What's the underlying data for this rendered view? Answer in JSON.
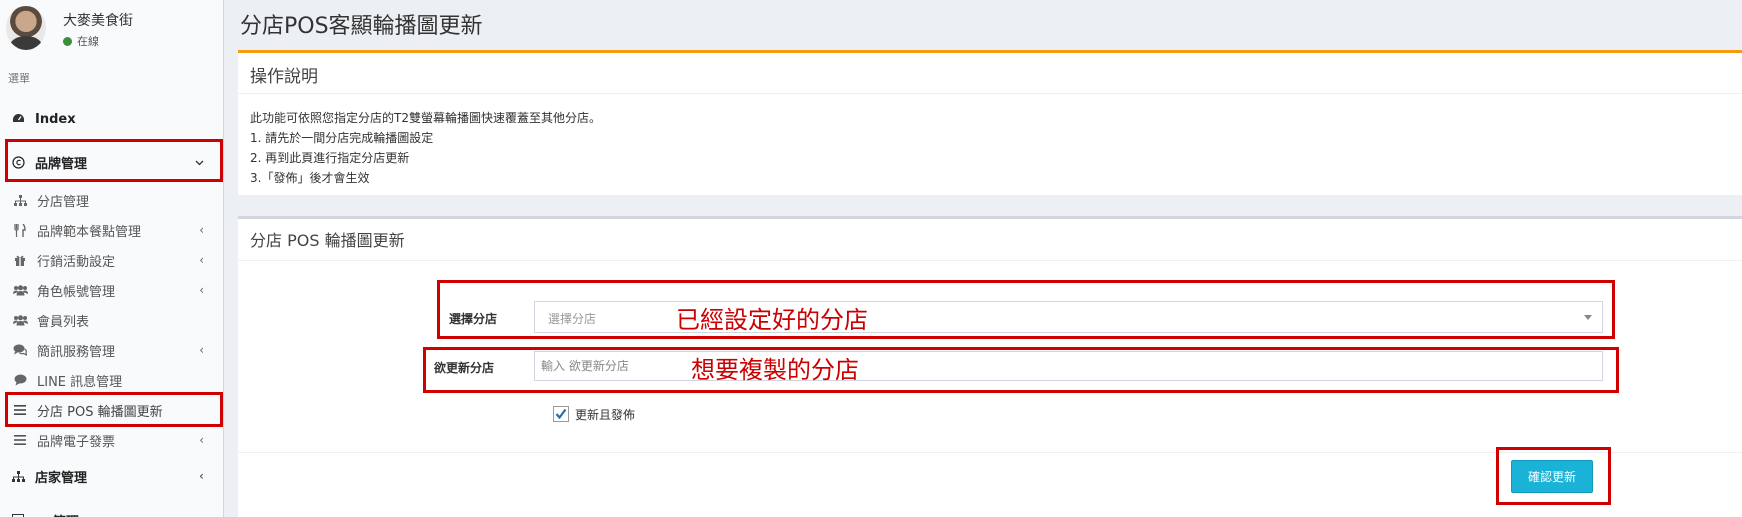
{
  "user": {
    "name": "大麥美食街",
    "status": "在線"
  },
  "sidebar": {
    "menu_header": "選單",
    "items": [
      {
        "label": "Index",
        "icon": "dashboard-icon"
      },
      {
        "label": "品牌管理",
        "icon": "copyright-icon",
        "expanded": true
      },
      {
        "label": "分店管理",
        "icon": "sitemap-icon"
      },
      {
        "label": "品牌範本餐點管理",
        "icon": "cutlery-icon"
      },
      {
        "label": "行銷活動設定",
        "icon": "gift-icon"
      },
      {
        "label": "角色帳號管理",
        "icon": "users-icon"
      },
      {
        "label": "會員列表",
        "icon": "users-icon"
      },
      {
        "label": "簡訊服務管理",
        "icon": "comments-icon"
      },
      {
        "label": "LINE 訊息管理",
        "icon": "comment-icon"
      },
      {
        "label": "分店 POS 輪播圖更新",
        "icon": "bars-icon",
        "active": true
      },
      {
        "label": "品牌電子發票",
        "icon": "bars-icon"
      },
      {
        "label": "店家管理",
        "icon": "sitemap-icon"
      },
      {
        "label": "管理",
        "icon": "square-icon"
      }
    ]
  },
  "page": {
    "title": "分店POS客顯輪播圖更新"
  },
  "instructions": {
    "title": "操作說明",
    "lines": [
      "此功能可依照您指定分店的T2雙螢幕輪播圖快速覆蓋至其他分店。",
      "1. 請先於一間分店完成輪播圖設定",
      "2. 再到此頁進行指定分店更新",
      "3.「發佈」後才會生效"
    ]
  },
  "form": {
    "title": "分店 POS 輪播圖更新",
    "select_label": "選擇分店",
    "select_placeholder": "選擇分店",
    "target_label": "欲更新分店",
    "target_placeholder": "輸入 欲更新分店",
    "checkbox_label": "更新且發佈",
    "checkbox_checked": true,
    "submit_label": "確認更新"
  },
  "annotations": {
    "source": "已經設定好的分店",
    "target": "想要複製的分店"
  },
  "colors": {
    "accent_top": "#f39c12",
    "button": "#1ab2d6",
    "annotation": "#d10000"
  }
}
